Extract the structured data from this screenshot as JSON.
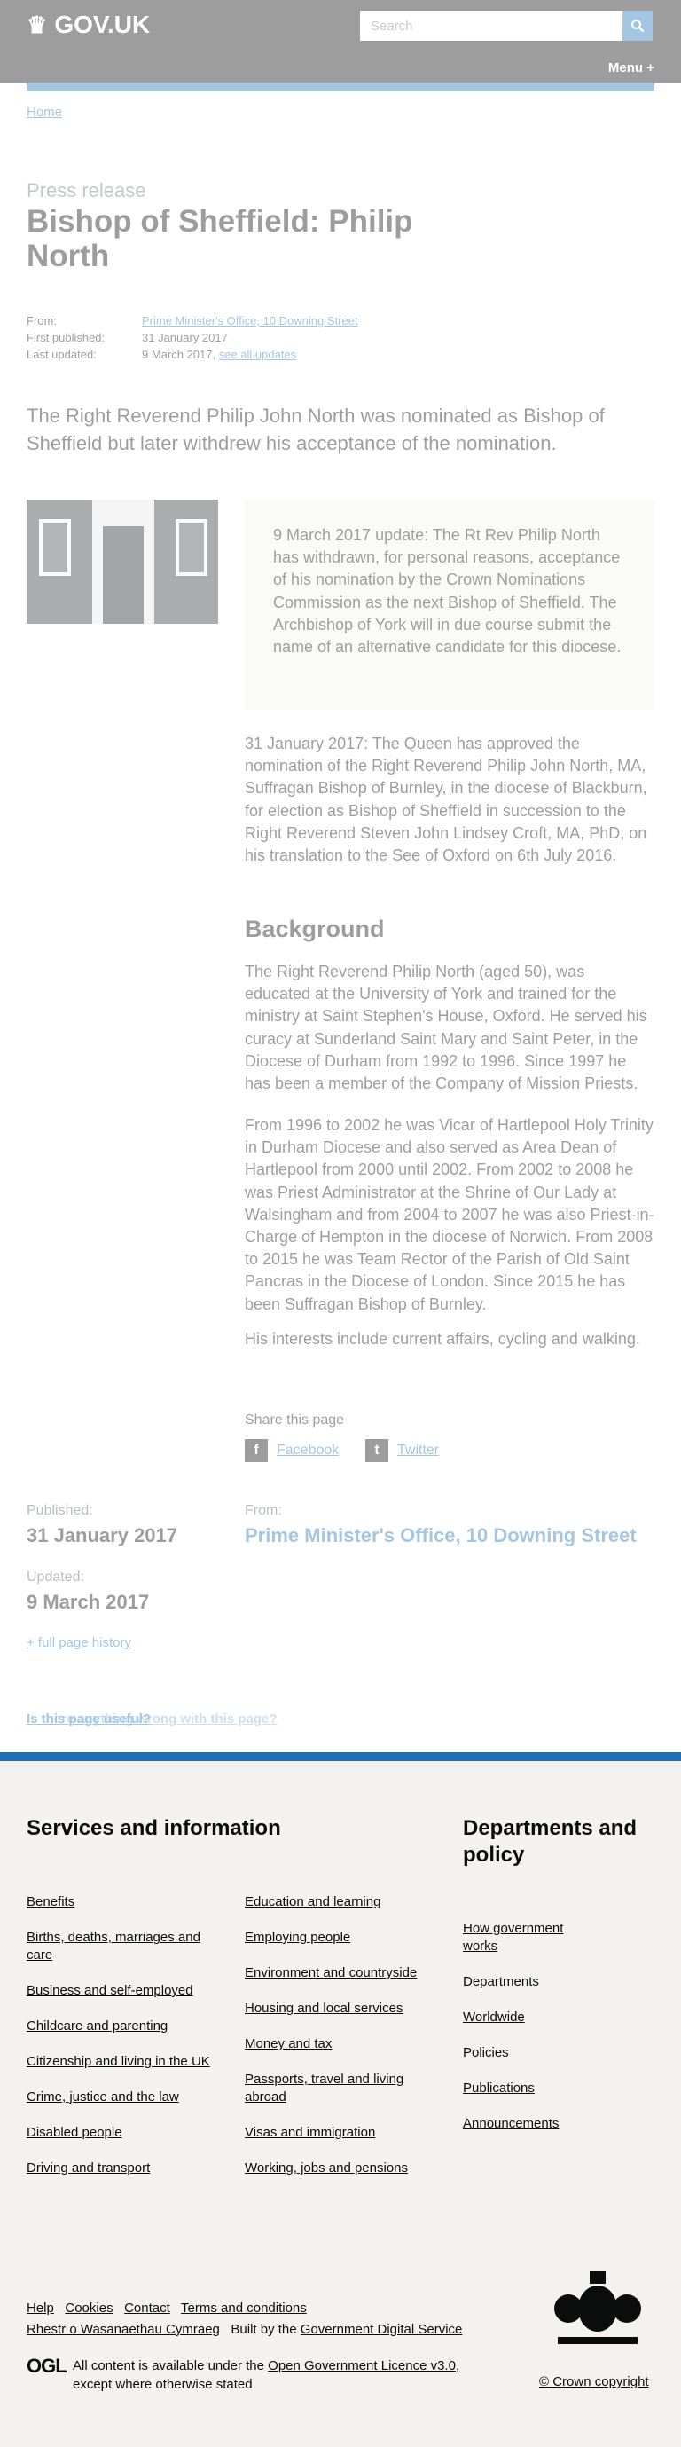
{
  "header": {
    "logo": "GOV.UK",
    "search_placeholder": "Search",
    "menu": "Menu +"
  },
  "breadcrumb": {
    "home": "Home"
  },
  "page": {
    "label": "Press release",
    "title": "Bishop of Sheffield: Philip North",
    "meta": {
      "from_label": "From:",
      "from_value": "Prime Minister's Office, 10 Downing Street",
      "first_published_label": "First published:",
      "first_published_value": "31 January 2017",
      "last_updated_label": "Last updated:",
      "last_updated_value": "9 March 2017,",
      "see_all_updates": "see all updates"
    },
    "lead": "The Right Reverend Philip John North was nominated as Bishop of Sheffield but later withdrew his acceptance of the nomination.",
    "callout": "9 March 2017 update: The Rt Rev Philip North has withdrawn, for personal reasons, acceptance of his nomination by the Crown Nominations Commission as the next Bishop of Sheffield. The Archbishop of York will in due course submit the name of an alternative candidate for this diocese.",
    "para1": "31 January 2017: The Queen has approved the nomination of the Right Reverend Philip John North, MA, Suffragan Bishop of Burnley, in the diocese of Blackburn, for election as Bishop of Sheffield in succession to the Right Reverend Steven John Lindsey Croft, MA, PhD, on his translation to the See of Oxford on 6th July 2016.",
    "background_heading": "Background",
    "para2": "The Right Reverend Philip North (aged 50), was educated at the University of York and trained for the ministry at Saint Stephen's House, Oxford. He served his curacy at Sunderland Saint Mary and Saint Peter, in the Diocese of Durham from 1992 to 1996. Since 1997 he has been a member of the Company of Mission Priests.",
    "para3": "From 1996 to 2002 he was Vicar of Hartlepool Holy Trinity in Durham Diocese and also served as Area Dean of Hartlepool from 2000 until 2002. From 2002 to 2008 he was Priest Administrator at the Shrine of Our Lady at Walsingham and from 2004 to 2007 he was also Priest-in-Charge of Hempton in the diocese of Norwich. From 2008 to 2015 he was Team Rector of the Parish of Old Saint Pancras in the Diocese of London. Since 2015 he has been Suffragan Bishop of Burnley.",
    "para4": "His interests include current affairs, cycling and walking."
  },
  "share": {
    "label": "Share this page",
    "facebook": "Facebook",
    "twitter": "Twitter"
  },
  "published": {
    "published_label": "Published:",
    "published_value": "31 January 2017",
    "updated_label": "Updated:",
    "updated_value": "9 March 2017",
    "full_history": "+ full page history",
    "from_label": "From:",
    "from_value": "Prime Minister's Office, 10 Downing Street"
  },
  "feedback": {
    "text": "Is this page useful?",
    "text_overlap": "Is there anything wrong with this page?"
  },
  "footer": {
    "services_heading": "Services and information",
    "departments_heading": "Departments and policy",
    "services_col1": [
      "Benefits",
      "Births, deaths, marriages and care",
      "Business and self-employed",
      "Childcare and parenting",
      "Citizenship and living in the UK",
      "Crime, justice and the law",
      "Disabled people",
      "Driving and transport"
    ],
    "services_col2": [
      "Education and learning",
      "Employing people",
      "Environment and countryside",
      "Housing and local services",
      "Money and tax",
      "Passports, travel and living abroad",
      "Visas and immigration",
      "Working, jobs and pensions"
    ],
    "departments": [
      "How government works",
      "Departments",
      "Worldwide",
      "Policies",
      "Publications",
      "Announcements"
    ],
    "meta_links": [
      "Help",
      "Cookies",
      "Contact",
      "Terms and conditions"
    ],
    "welsh": "Rhestr o Wasanaethau Cymraeg",
    "built_by": "Built by the",
    "gds": "Government Digital Service",
    "ogl": "OGL",
    "licence_pre": "All content is available under the",
    "licence_link": "Open Government Licence v3.0",
    "licence_post": ", except where otherwise stated",
    "copyright": "© Crown copyright"
  }
}
